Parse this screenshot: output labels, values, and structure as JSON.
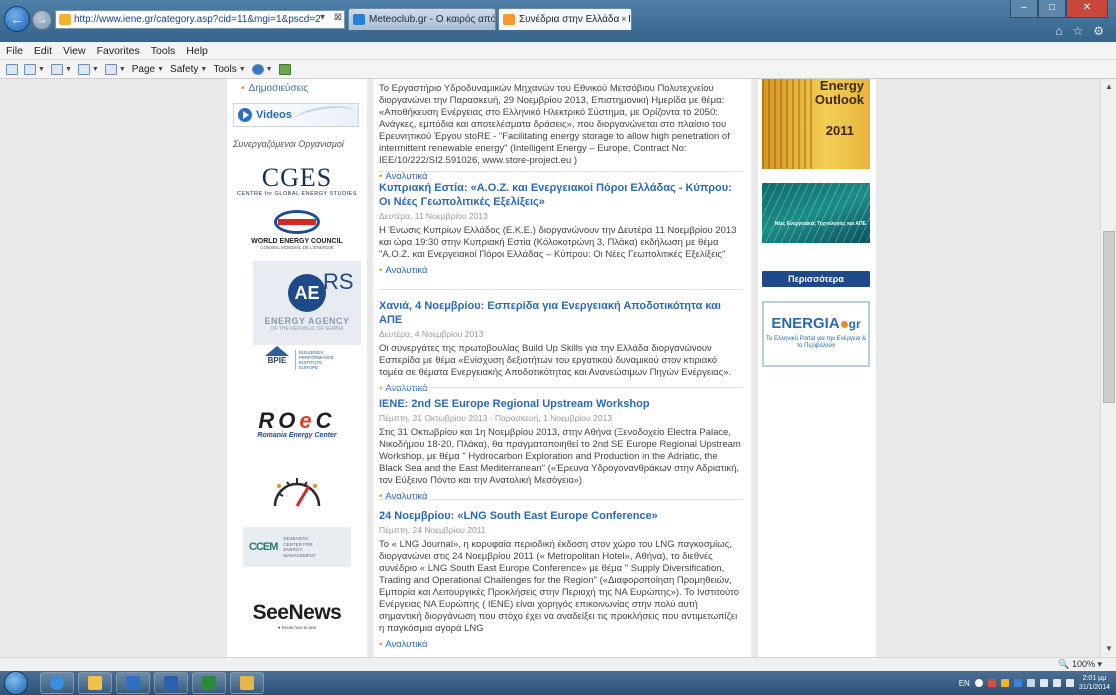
{
  "browser": {
    "address": "http://www.iene.gr/category.asp?cid=11&mgi=1&pscd=2",
    "address_tools": "▾ ⊠ C",
    "tabs": [
      {
        "label": "Meteoclub.gr - Ο καιρός από ε..."
      },
      {
        "label": "Συνέδρια στην Ελλάδα - IENE",
        "close": "×"
      }
    ],
    "window_buttons": {
      "min": "–",
      "max": "□",
      "close": "✕"
    },
    "right_icons": [
      "⌂",
      "☆",
      "⚙"
    ]
  },
  "menubar": [
    "File",
    "Edit",
    "View",
    "Favorites",
    "Tools",
    "Help"
  ],
  "cmdbar": {
    "page": "Page",
    "safety": "Safety",
    "tools": "Tools"
  },
  "sidebar": {
    "link": "Δημοσιεύσεις",
    "videos": "Videos",
    "partners_heading": "Συνεργαζόμενοι Οργανισμοί",
    "partners": {
      "cges": {
        "big": "CGES",
        "small": "CENTRE for GLOBAL ENERGY STUDIES"
      },
      "wec": {
        "t1": "WORLD ENERGY COUNCIL",
        "t2": "CONSEIL MONDIAL DE L'ÉNERGIE"
      },
      "aers": {
        "ae": "AE",
        "rs": "RS",
        "t1": "ENERGY AGENCY",
        "t2": "OF THE REPUBLIC OF SERBIA"
      },
      "bpie": {
        "name": "BPIE",
        "sub": "BUILDINGS PERFORMANCE INSTITUTE EUROPE"
      },
      "roec": {
        "ro": "RO",
        "e": "e",
        "c": "C",
        "sub": "Romania Energy Center"
      },
      "ccem": {
        "dots": "CCEM",
        "txt": "RESEARCH CENTER FOR ENERGY MANAGEMENT"
      },
      "seenews": {
        "big": "SeeNews",
        "sub": "● Know how to see"
      }
    }
  },
  "articles": [
    {
      "title": "",
      "date": "",
      "body": "Το Εργαστήριο Υδροδυναμικών Μηχανών του Εθνικού Μετσόβιου Πολυτεχνείου διοργανώνει την Παρασκευή, 29 Νοεμβρίου 2013, Επιστημονική Ημερίδα με θέμα: «Αποθήκευση Ενέργειας στο Ελληνικό Ηλεκτρικό Σύστημα, με Ορίζοντα το 2050: Ανάγκες, εμπόδια και αποτελέσματα δράσεις», που διοργανώνεται στο πλαίσιο του Ερευνητικού Έργου stoRE - \"Facilitating energy storage to allow high penetration of intermittent renewable energy\" (Intelligent Energy – Europe, Contract No: IEE/10/222/SI2.591026, www.store-project.eu )",
      "more": "Αναλυτικά"
    },
    {
      "title": "Κυπριακή Εστία: «Α.Ο.Ζ. και Ενεργειακοί Πόροι Ελλάδας - Κύπρου: Οι Νέες Γεωπολιτικές Εξελίξεις»",
      "date": "Δευτέρα, 11 Νοεμβρίου 2013",
      "body": "Η Ένωσις Κυπρίων Ελλάδος (Ε.Κ.Ε.) διοργανώνουν την Δευτέρα 11 Νοεμβρίου 2013 και ώρα 19:30 στην Κυπριακή Εστία (Κόλοκοτρώνη 3, Πλάκα) εκδήλωση με θέμα \"Α.Ο.Ζ. και Ενεργειακοί Πόροι Ελλάδας – Κύπρου: Οι Νέες Γεωπολιτικές Εξελίξεις\"",
      "more": "Αναλυτικά"
    },
    {
      "title": "Χανιά, 4 Νοεμβρίου: Εσπερίδα για Ενεργειακή Αποδοτικότητα και ΑΠΕ",
      "date": "Δευτέρα, 4 Νοεμβρίου 2013",
      "body": "Οι συνεργάτες της πρωτοβουλίας Build Up Skills για την Ελλάδα διοργανώνουν Εσπερίδα με θέμα «Ενίσχυση δεξιοτήτων του εργατικού δυναμικού στον κτιριακό τομέα σε θέματα Ενεργειακής Αποδοτικότητας και Ανανεώσιμων Πηγών Ενέργειας».",
      "more": "Αναλυτικά"
    },
    {
      "title": "IENE: 2nd SE Europe Regional Upstream Workshop",
      "date": "Πέμπτη, 31 Οκτωβρίου 2013 - Παρασκευή, 1 Νοεμβρίου 2013",
      "body": "Στις 31 Οκτωβρίου και 1η Νοεμβρίου 2013, στην Αθήνα (Ξενοδοχείο Electra Palace, Νικοδήμου 18-20, Πλάκα), θα πραγματοποιηθεί το 2nd SE Europe Regional Upstream Workshop, με θέμα \" Hydrocarbon Exploration and Production in the Adriatic, the Black Sea and the East Mediterranean\" («Έρευνα Υδρογονανθράκων στην Αδριατική, τον Εύξεινο Πόντο και την Ανατολική Μεσόγειο»)",
      "more": "Αναλυτικά"
    },
    {
      "title": "24 Νοεμβρίου: «LNG South East Europe Conference»",
      "date": "Πέμπτη, 24 Νοεμβρίου 2011",
      "body": "Το « LNG Journal», η κορυφαία περιοδική έκδοση στον χώρο του LNG παγκοσμίως, διοργανώνει στις 24 Νοεμβρίου 2011 (« Metropolitan Hotel», Αθήνα), το διεθνές συνέδριο « LNG South East Europe Conference» με θέμα \" Supply Diversification, Trading and Operational Challenges for the Region\" («Διαφοροποίηση Προμηθειών, Εμπορία και Λειτουργικές Προκλήσεις στην Περιοχή της ΝΑ Ευρώπης»). Το Ινστιτούτο Ενέργειας ΝΑ Ευρώπης ( ΙΕΝΕ) είναι χορηγός επικοινωνίας στην πολύ αυτή σημαντική διοργάνωση που στόχο έχει να αναδείξει τις προκλήσεις που αντιμετωπίζει η παγκόσμια αγορά LNG",
      "more": "Αναλυτικά"
    }
  ],
  "right": {
    "book": {
      "t1": "Energy\nOutlook",
      "year": "2011"
    },
    "bridge": "Νέες Ενεργειακές Τεχνολογίες και ΑΠΕ",
    "more_button": "Περισσότερα",
    "energia": {
      "name": "ENERGIA",
      "gr": "gr",
      "sub": "Το Ελληνικό Portal για την Ενέργεια & το Περιβάλλον"
    }
  },
  "status": {
    "zoom": "100%"
  },
  "taskbar": {
    "lang": "EN",
    "time": "2:01 μμ",
    "date": "31/1/2014"
  },
  "colors": {
    "link": "#2b69b4",
    "bullet": "#e48d25",
    "brand_navy": "#1e4a8a"
  }
}
